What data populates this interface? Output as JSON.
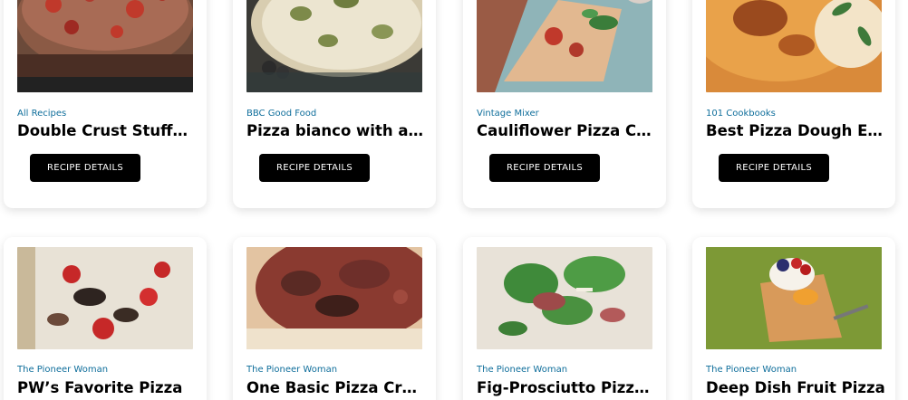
{
  "recipes": [
    {
      "source": "All Recipes",
      "title": "Double Crust Stuffed Pizza",
      "button": "RECIPE DETAILS",
      "image": "stuffed-pizza-photo"
    },
    {
      "source": "BBC Good Food",
      "title": "Pizza bianco with artichoke hearts",
      "button": "RECIPE DETAILS",
      "image": "artichoke-pizza-photo"
    },
    {
      "source": "Vintage Mixer",
      "title": "Cauliflower Pizza Crust",
      "button": "RECIPE DETAILS",
      "image": "cauliflower-pizza-photo"
    },
    {
      "source": "101 Cookbooks",
      "title": "Best Pizza Dough Ever",
      "button": "RECIPE DETAILS",
      "image": "pizza-dough-photo"
    },
    {
      "source": "The Pioneer Woman",
      "title": "PW’s Favorite Pizza",
      "image": "favorite-pizza-photo"
    },
    {
      "source": "The Pioneer Woman",
      "title": "One Basic Pizza Crust",
      "image": "basic-crust-photo"
    },
    {
      "source": "The Pioneer Woman",
      "title": "Fig-Prosciutto Pizza with Arugula",
      "image": "fig-prosciutto-photo"
    },
    {
      "source": "The Pioneer Woman",
      "title": "Deep Dish Fruit Pizza",
      "image": "fruit-pizza-photo"
    }
  ],
  "colors": {
    "source_text": "#0f6e9b",
    "button_bg": "#000000",
    "button_text": "#ffffff"
  }
}
